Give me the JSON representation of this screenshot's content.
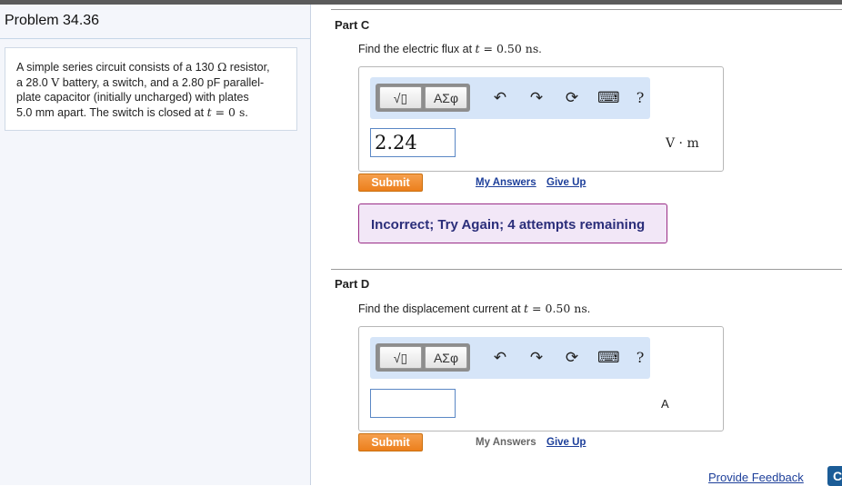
{
  "problem": {
    "title": "Problem 34.36",
    "description": {
      "pre_resistor": "A simple series circuit consists of a 130 ",
      "ohm_symbol": "Ω",
      "post_resistor": " resistor,",
      "line2_pre": "a 28.0 ",
      "volt_symbol": "V",
      "line2_post": " battery, a switch, and a 2.80 pF parallel-",
      "line3": "plate capacitor (initially uncharged) with plates",
      "line4_pre": "5.0 mm apart. The switch is closed at ",
      "t_symbol": "t",
      "equals": " = ",
      "zero_time": "0 s",
      "period": "."
    }
  },
  "toolbar": {
    "sqrt_label": "√▯",
    "greek_label": "ΑΣφ",
    "undo_glyph": "↶",
    "redo_glyph": "↷",
    "reset_glyph": "⟳",
    "keyboard_glyph": "⌨",
    "help_label": "?"
  },
  "part_c": {
    "title": "Part C",
    "question_pre": "Find the electric flux at ",
    "t_symbol": "t",
    "equals": " = ",
    "time_value": "0.50 ns",
    "period": ".",
    "answer_value": "2.24",
    "unit": "V · m",
    "submit_label": "Submit",
    "my_answers_label": "My Answers",
    "give_up_label": "Give Up",
    "feedback": "Incorrect; Try Again; 4 attempts remaining"
  },
  "part_d": {
    "title": "Part D",
    "question_pre": "Find the displacement current at ",
    "t_symbol": "t",
    "equals": " = ",
    "time_value": "0.50 ns",
    "period": ".",
    "answer_value": "",
    "unit": "A",
    "submit_label": "Submit",
    "my_answers_label": "My Answers",
    "give_up_label": "Give Up"
  },
  "footer": {
    "provide_feedback_label": "Provide Feedback",
    "corner_button_label": "C"
  },
  "colors": {
    "submit_orange": "#ee8a2a",
    "link_blue": "#1d3f9a",
    "feedback_border": "#9a2d86",
    "feedback_bg": "#f2e7f7",
    "toolbar_bg": "#d6e5f8"
  }
}
